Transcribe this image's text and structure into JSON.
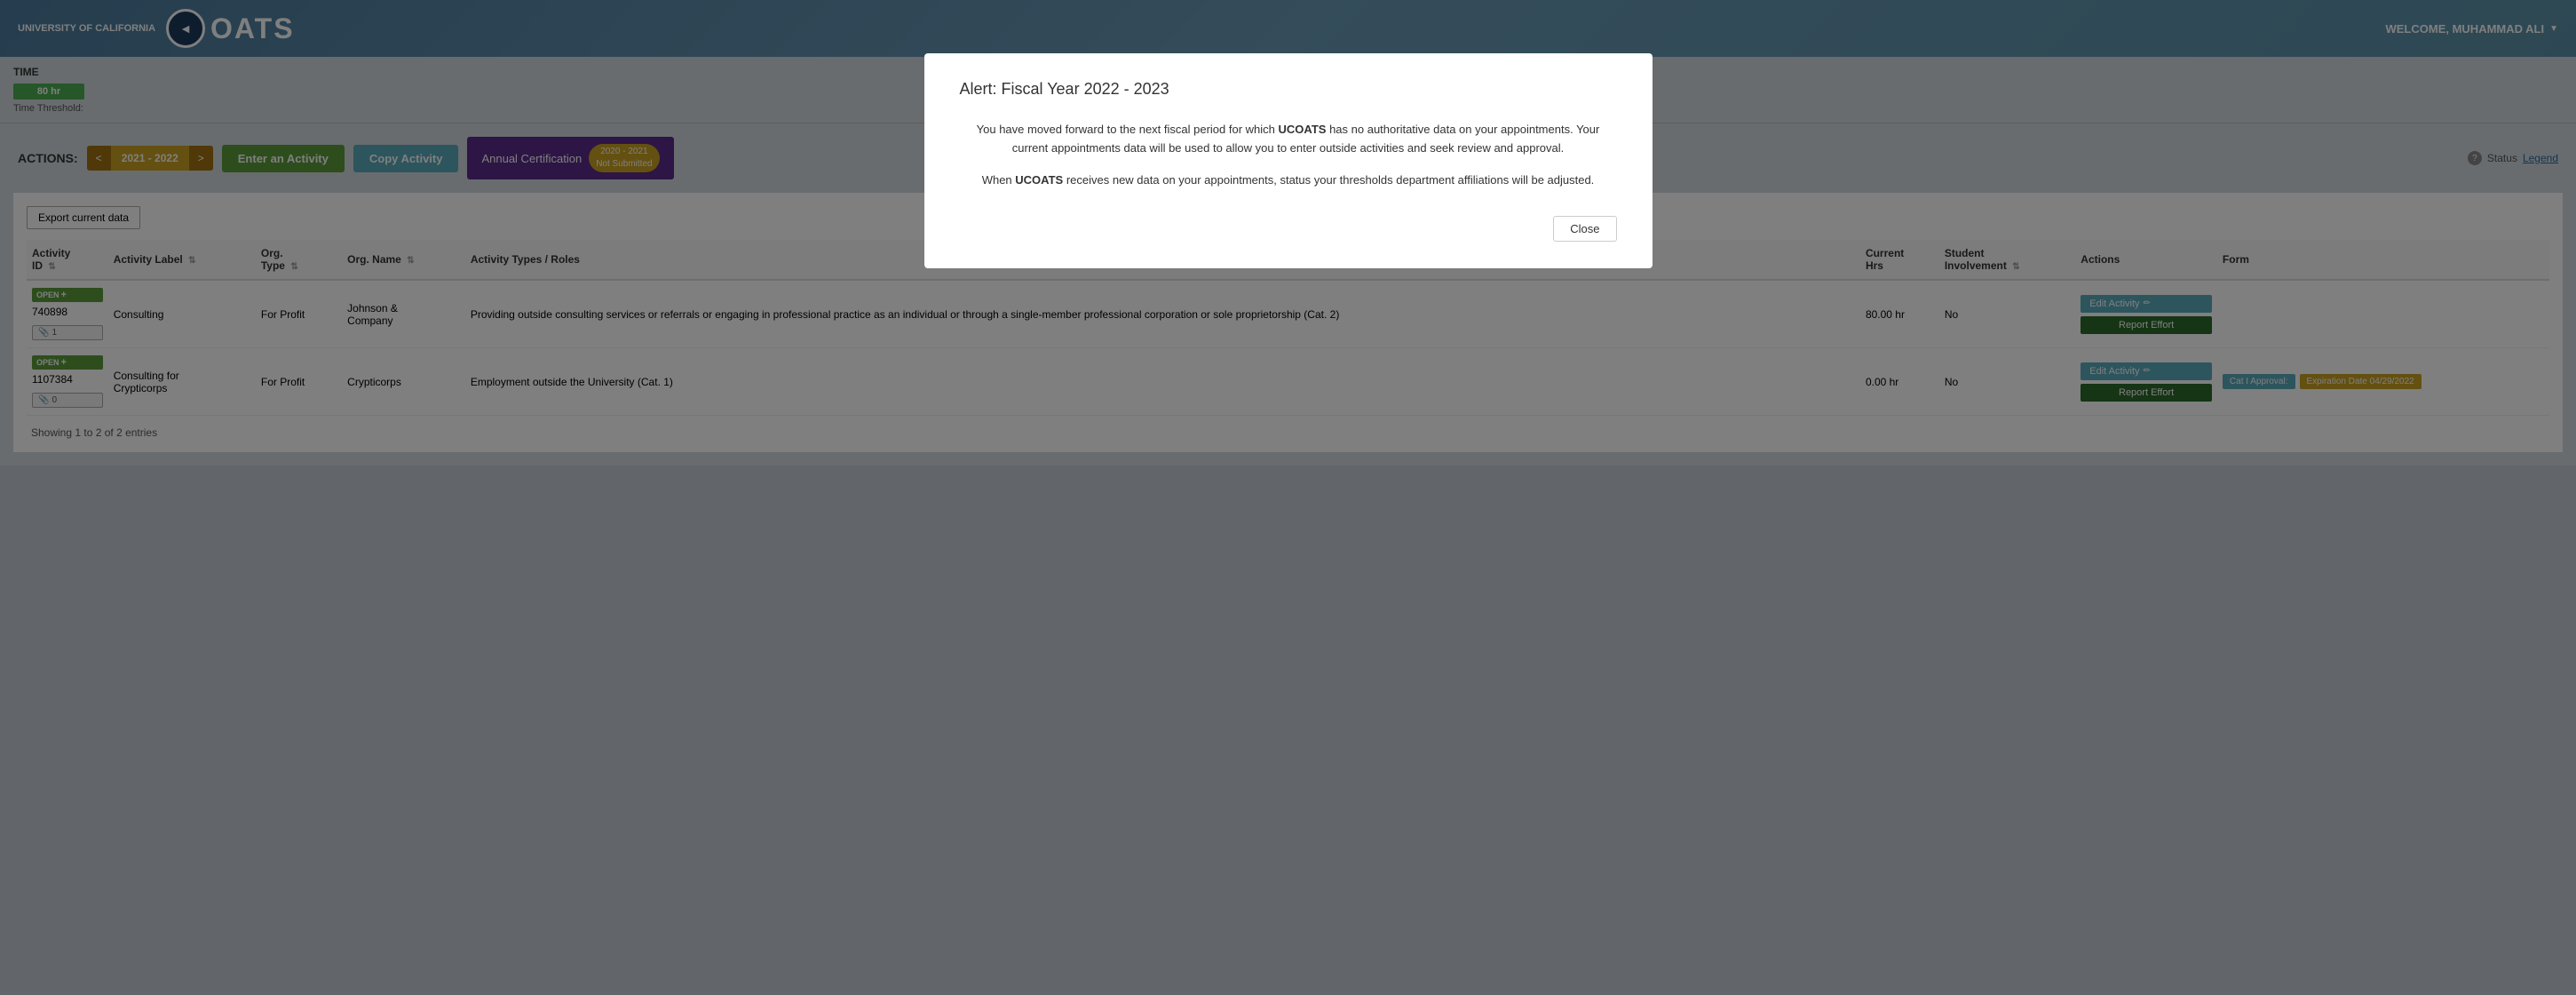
{
  "header": {
    "uc_text": "UNIVERSITY\nOF\nCALIFORNIA",
    "app_name": "OATS",
    "welcome_text": "WELCOME, MUHAMMAD ALI"
  },
  "modal": {
    "title": "Alert: Fiscal Year 2022 - 2023",
    "body_line1": "You have moved forward to the next fiscal period for which UCOATS has no authoritative data on your appointments. Your current appointments data will be used to allow you to enter outside activities and seek review and approval.",
    "body_line1_bold": "UCOATS",
    "body_line2": "When UCOATS receives new data on your appointments, status your thresholds department affiliations will be adjusted.",
    "body_line2_bold": "UCOATS",
    "close_label": "Close"
  },
  "time_section": {
    "label": "TIME",
    "bar_value": "80 hr",
    "threshold_label": "Time Threshold:"
  },
  "actions": {
    "label": "ACTIONS:",
    "fiscal_year": {
      "prev_label": "<",
      "year_label": "2021 - 2022",
      "next_label": ">"
    },
    "enter_activity_label": "Enter an Activity",
    "copy_activity_label": "Copy Activity",
    "annual_certification": {
      "label": "Annual Certification",
      "badge_line1": "2020 - 2021",
      "badge_line2": "Not Submitted"
    },
    "status_label": "Status",
    "legend_label": "Legend"
  },
  "table": {
    "export_label": "Export current data",
    "columns": [
      "Activity ID",
      "Activity Label",
      "Org. Type",
      "Org. Name",
      "Activity Types / Roles",
      "Current Hrs",
      "Student Involvement",
      "Actions",
      "Form"
    ],
    "rows": [
      {
        "status": "OPEN",
        "activity_id": "740898",
        "activity_label": "Consulting",
        "org_type": "For Profit",
        "org_name": "Johnson & Company",
        "activity_types": "Providing outside consulting services or referrals or engaging in professional practice as an individual or through a single-member professional corporation or sole proprietorship (Cat. 2)",
        "current_hrs": "80.00 hr",
        "student_involvement": "No",
        "attach_count": "1",
        "actions": {
          "edit_label": "Edit Activity",
          "report_label": "Report Effort"
        },
        "form": null,
        "form_badge": null
      },
      {
        "status": "OPEN",
        "activity_id": "1107384",
        "activity_label": "Consulting for Crypticorps",
        "org_type": "For Profit",
        "org_name": "Crypticorps",
        "activity_types": "Employment outside the University (Cat. 1)",
        "current_hrs": "0.00 hr",
        "student_involvement": "No",
        "attach_count": "0",
        "actions": {
          "edit_label": "Edit Activity",
          "report_label": "Report Effort"
        },
        "form_cat_label": "Cat I Approval:",
        "form_expiry_label": "Expiration Date 04/29/2022"
      }
    ],
    "showing_text": "Showing 1 to 2 of 2 entries"
  }
}
